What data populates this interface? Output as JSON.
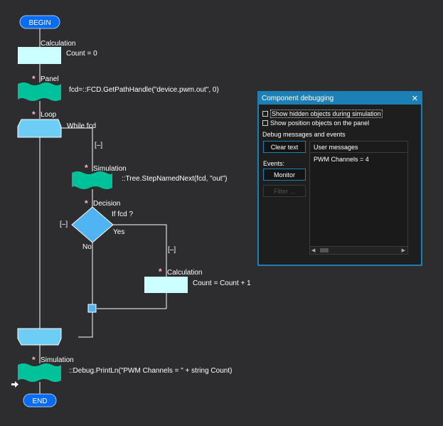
{
  "flowchart": {
    "begin_label": "BEGIN",
    "end_label": "END",
    "calc1": {
      "title": "Calculation",
      "code": "Count = 0"
    },
    "panel": {
      "title": "Panel",
      "code": "fcd=::FCD.GetPathHandle(\"device.pwm.out\", 0)"
    },
    "loop": {
      "title": "Loop",
      "code": "While fcd",
      "collapse": "[–]"
    },
    "sim1": {
      "title": "Simulation",
      "code": "::Tree.StepNamedNext(fcd, \"out\")"
    },
    "decision": {
      "title": "Decision",
      "code": "If fcd ?",
      "yes": "Yes",
      "no": "No",
      "collapse_left": "[–]",
      "collapse_right": "[–]"
    },
    "calc2": {
      "title": "Calculation",
      "code": "Count = Count + 1"
    },
    "sim2": {
      "title": "Simulation",
      "code": "::Debug.PrintLn(\"PWM Channels = \" + string Count)"
    },
    "star": "*"
  },
  "debug": {
    "title": "Component debugging",
    "close": "✕",
    "show_hidden": "Show hidden objects during simulation",
    "show_position": "Show position objects on the panel",
    "section_title": "Debug messages and events",
    "clear_text": "Clear text",
    "events_label": "Events:",
    "monitor": "Monitor",
    "filter": "Filter ...",
    "messages_header": "User messages",
    "message_line": "PWM Channels = 4"
  },
  "colors": {
    "background": "#2d2d30",
    "accent": "#1c7fb5",
    "calc_fill": "#ccffff",
    "panel_fill": "#00c29a",
    "loop_fill": "#6ecdf5",
    "decision_fill": "#4fb4f1",
    "terminal_fill": "#0a6cf2"
  }
}
